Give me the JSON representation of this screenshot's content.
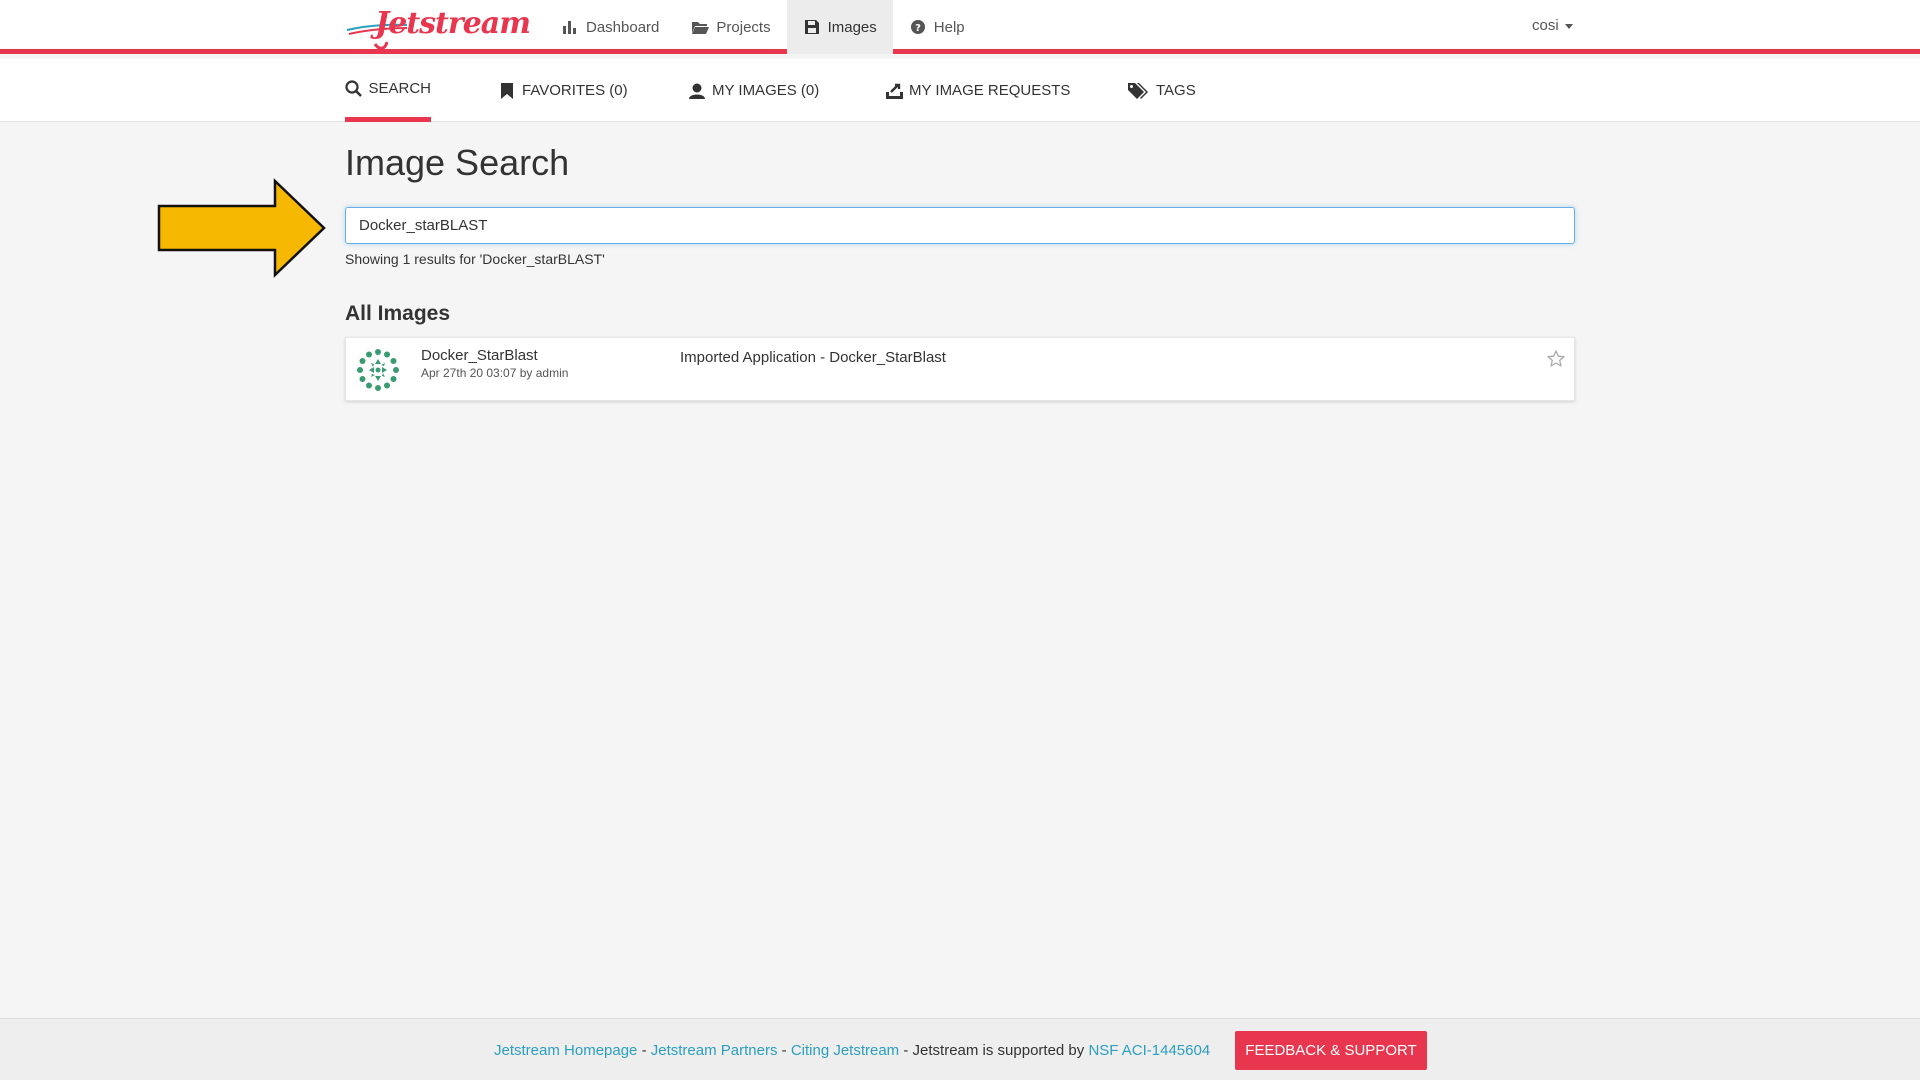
{
  "brand": {
    "logo_text": "Jetstream",
    "accent_color": "#e8364f",
    "link_color": "#2a9fbf"
  },
  "nav": {
    "items": [
      {
        "label": "Dashboard",
        "icon": "bar-chart-icon"
      },
      {
        "label": "Projects",
        "icon": "folder-open-icon"
      },
      {
        "label": "Images",
        "icon": "floppy-disk-icon",
        "active": true
      },
      {
        "label": "Help",
        "icon": "question-circle-icon"
      }
    ],
    "user": "cosi"
  },
  "subnav": {
    "items": [
      {
        "label": "SEARCH",
        "icon": "search-icon",
        "active": true
      },
      {
        "label": "FAVORITES (0)",
        "icon": "bookmark-icon"
      },
      {
        "label": "MY IMAGES (0)",
        "icon": "user-icon"
      },
      {
        "label": "MY IMAGE REQUESTS",
        "icon": "image-request-icon"
      },
      {
        "label": "TAGS",
        "icon": "tags-icon"
      }
    ]
  },
  "main": {
    "title": "Image Search",
    "search": {
      "value": "Docker_starBLAST",
      "placeholder": ""
    },
    "results_text": "Showing 1 results for 'Docker_starBLAST'",
    "section_title": "All Images",
    "images": [
      {
        "name": "Docker_StarBlast",
        "meta": "Apr 27th 20 03:07 by admin",
        "description": "Imported Application - Docker_StarBlast"
      }
    ]
  },
  "footer": {
    "link_homepage": "Jetstream Homepage",
    "sep1": " - ",
    "link_partners": "Jetstream Partners",
    "sep2": " - ",
    "link_citing": "Citing Jetstream",
    "supported_text": " - Jetstream is supported by ",
    "link_nsf": "NSF ACI-1445604",
    "feedback_button": "FEEDBACK & SUPPORT"
  }
}
